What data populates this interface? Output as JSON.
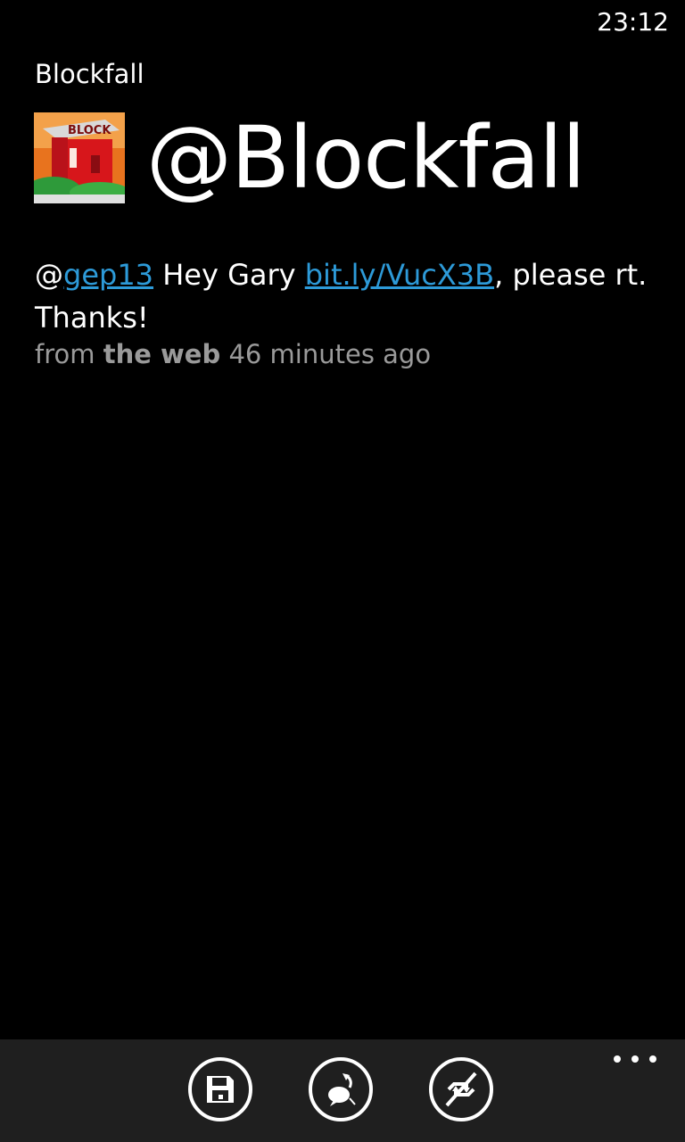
{
  "status": {
    "time": "23:12"
  },
  "app": {
    "title": "Blockfall"
  },
  "profile": {
    "handle": "@Blockfall",
    "avatar_icon": "blockfall-logo"
  },
  "tweet": {
    "at_prefix": "@",
    "mention": "gep13",
    "text_after_mention": " Hey Gary ",
    "link": "bit.ly/VucX3B",
    "text_after_link": ", please rt. Thanks!",
    "link_color": "#2d9ad8"
  },
  "meta": {
    "from_label": "from",
    "source": "the web",
    "time_ago": "46 minutes ago"
  },
  "appbar": {
    "buttons": [
      {
        "icon": "save-icon"
      },
      {
        "icon": "reply-icon"
      },
      {
        "icon": "retweet-icon"
      }
    ],
    "more_icon": "ellipsis-icon"
  }
}
